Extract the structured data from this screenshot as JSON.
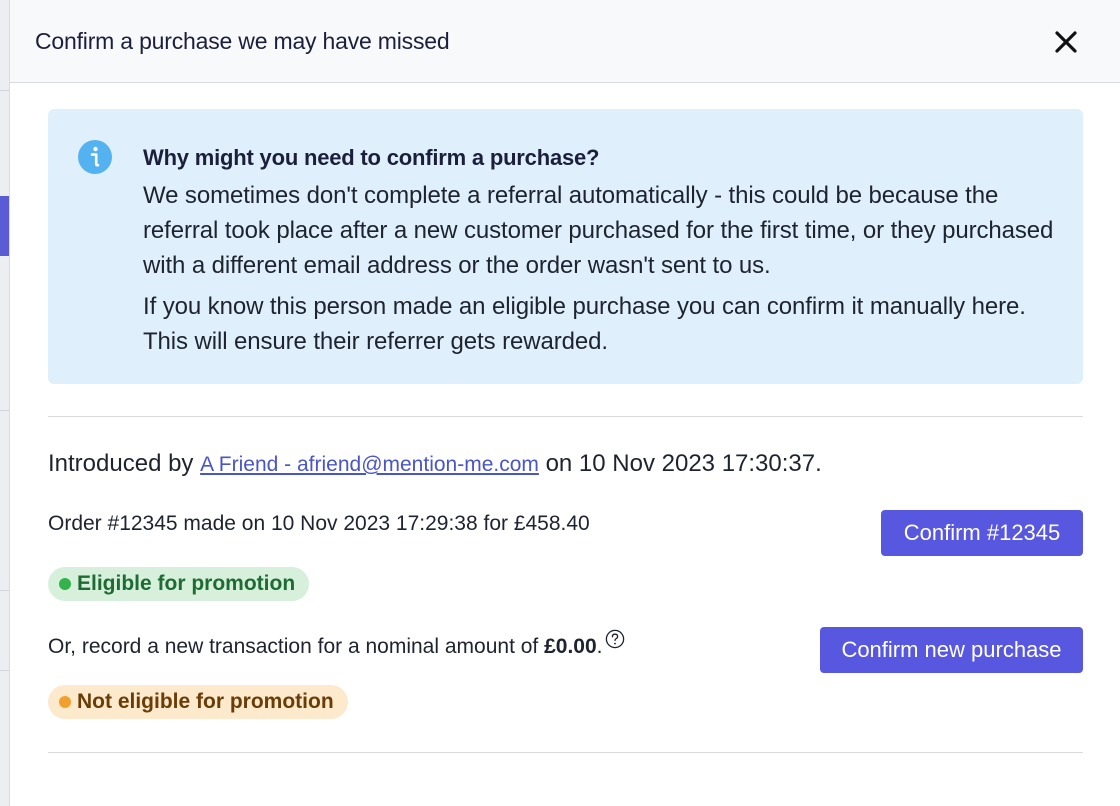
{
  "modal": {
    "title": "Confirm a purchase we may have missed",
    "close_icon": "close-icon"
  },
  "info": {
    "icon": "info-icon",
    "heading": "Why might you need to confirm a purchase?",
    "paragraph1": "We sometimes don't complete a referral automatically - this could be because the referral took place after a new customer purchased for the first time, or they purchased with a different email address or the order wasn't sent to us.",
    "paragraph2": "If you know this person made an eligible purchase you can confirm it manually here. This will ensure their referrer gets rewarded."
  },
  "referral": {
    "prefix": "Introduced by",
    "referrer_link": "A Friend - afriend@mention-me.com",
    "suffix": "on 10 Nov 2023 17:30:37."
  },
  "order": {
    "text": "Order #12345 made on 10 Nov 2023 17:29:38 for £458.40",
    "confirm_button": "Confirm #12345",
    "badge": "Eligible for promotion"
  },
  "nominal": {
    "text": "Or, record a new transaction for a nominal amount of",
    "amount": "£0.00",
    "end": ".",
    "help_icon": "help-circle-icon",
    "confirm_button": "Confirm new purchase",
    "badge": "Not eligible for promotion"
  },
  "colors": {
    "primary": "#5757e0",
    "info_bg": "#dff0fc",
    "info_icon": "#55b2f0",
    "eligible_bg": "#d7f0dc",
    "eligible_dot": "#36b24c",
    "not_eligible_bg": "#fde9cc",
    "not_eligible_dot": "#f2a02c"
  }
}
